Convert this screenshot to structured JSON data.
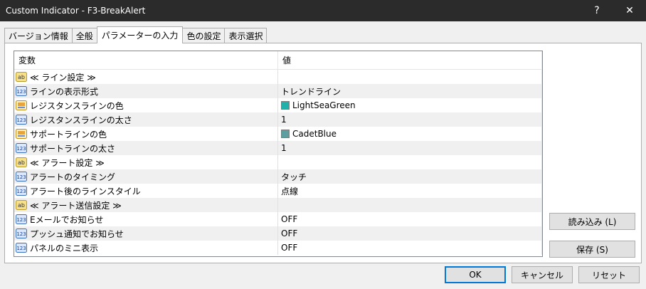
{
  "window": {
    "title": "Custom Indicator - F3-BreakAlert",
    "help_label": "?",
    "close_label": "✕"
  },
  "tabs": [
    {
      "label": "バージョン情報"
    },
    {
      "label": "全般"
    },
    {
      "label": "パラメーターの入力"
    },
    {
      "label": "色の設定"
    },
    {
      "label": "表示選択"
    }
  ],
  "grid": {
    "col_variable": "変数",
    "col_value": "値",
    "rows": [
      {
        "icon": "ab",
        "name": "≪ ライン設定 ≫",
        "value": ""
      },
      {
        "icon": "123",
        "name": "ラインの表示形式",
        "value": "トレンドライン"
      },
      {
        "icon": "color",
        "name": "レジスタンスラインの色",
        "value": "LightSeaGreen",
        "color": "#20B2AA"
      },
      {
        "icon": "123",
        "name": "レジスタンスラインの太さ",
        "value": "1"
      },
      {
        "icon": "color",
        "name": "サポートラインの色",
        "value": "CadetBlue",
        "color": "#5F9EA0"
      },
      {
        "icon": "123",
        "name": "サポートラインの太さ",
        "value": "1"
      },
      {
        "icon": "ab",
        "name": "≪ アラート設定 ≫",
        "value": ""
      },
      {
        "icon": "123",
        "name": "アラートのタイミング",
        "value": "タッチ"
      },
      {
        "icon": "123",
        "name": "アラート後のラインスタイル",
        "value": "点線"
      },
      {
        "icon": "ab",
        "name": "≪ アラート送信設定 ≫",
        "value": ""
      },
      {
        "icon": "123",
        "name": "Eメールでお知らせ",
        "value": "OFF"
      },
      {
        "icon": "123",
        "name": "プッシュ通知でお知らせ",
        "value": "OFF"
      },
      {
        "icon": "123",
        "name": "パネルのミニ表示",
        "value": "OFF"
      }
    ]
  },
  "buttons": {
    "load": "読み込み (L)",
    "save": "保存 (S)",
    "ok": "OK",
    "cancel": "キャンセル",
    "reset": "リセット"
  }
}
